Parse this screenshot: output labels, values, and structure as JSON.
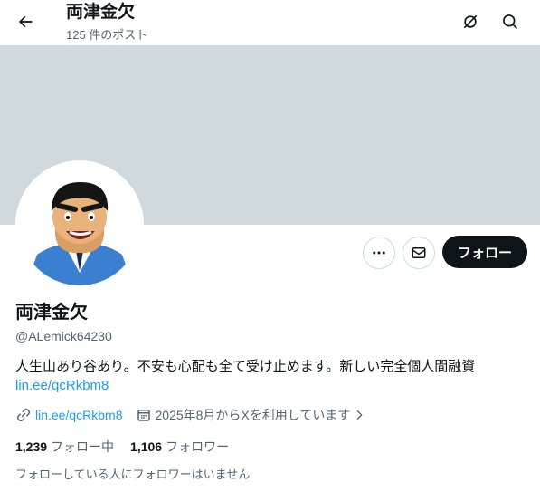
{
  "header": {
    "title": "両津金欠",
    "post_count": "125 件のポスト",
    "back_icon": "arrow-left-icon",
    "grok_icon": "grok-icon",
    "search_icon": "search-icon"
  },
  "profile": {
    "name": "両津金欠",
    "handle": "@ALemick64230",
    "bio_text": "人生山あり谷あり。不安も心配も全て受け止めます。新しい完全個人間融資",
    "bio_link": "lin.ee/qcRkbm8",
    "website": "lin.ee/qcRkbm8",
    "joined": "2025年8月からXを利用しています",
    "following_count": "1,239",
    "following_label": "フォロー中",
    "followers_count": "1,106",
    "followers_label": "フォロワー",
    "followers_note": "フォローしている人にフォロワーはいません"
  },
  "actions": {
    "follow_label": "フォロー",
    "more_icon": "more-dots-icon",
    "message_icon": "envelope-icon"
  },
  "colors": {
    "banner": "#cfd9de",
    "link": "#1d9bf0",
    "secondary_text": "#536471",
    "follow_button": "#0f1419"
  }
}
